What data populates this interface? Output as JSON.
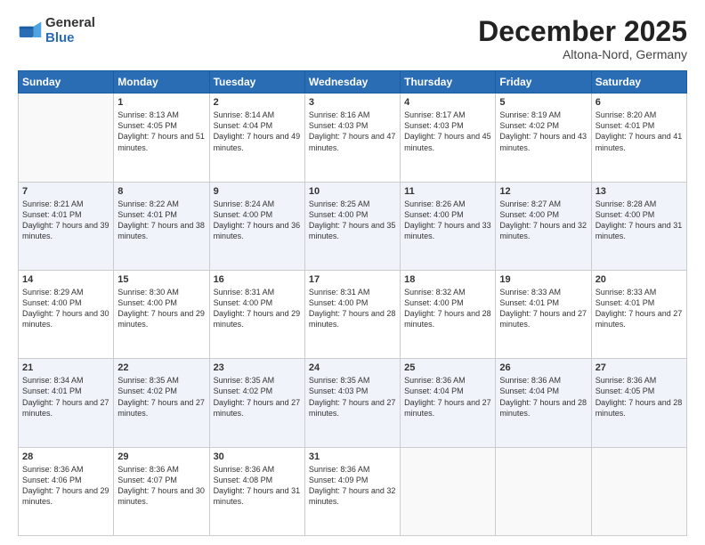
{
  "logo": {
    "general": "General",
    "blue": "Blue"
  },
  "header": {
    "month": "December 2025",
    "location": "Altona-Nord, Germany"
  },
  "weekdays": [
    "Sunday",
    "Monday",
    "Tuesday",
    "Wednesday",
    "Thursday",
    "Friday",
    "Saturday"
  ],
  "weeks": [
    [
      {
        "day": "",
        "sunrise": "",
        "sunset": "",
        "daylight": ""
      },
      {
        "day": "1",
        "sunrise": "Sunrise: 8:13 AM",
        "sunset": "Sunset: 4:05 PM",
        "daylight": "Daylight: 7 hours and 51 minutes."
      },
      {
        "day": "2",
        "sunrise": "Sunrise: 8:14 AM",
        "sunset": "Sunset: 4:04 PM",
        "daylight": "Daylight: 7 hours and 49 minutes."
      },
      {
        "day": "3",
        "sunrise": "Sunrise: 8:16 AM",
        "sunset": "Sunset: 4:03 PM",
        "daylight": "Daylight: 7 hours and 47 minutes."
      },
      {
        "day": "4",
        "sunrise": "Sunrise: 8:17 AM",
        "sunset": "Sunset: 4:03 PM",
        "daylight": "Daylight: 7 hours and 45 minutes."
      },
      {
        "day": "5",
        "sunrise": "Sunrise: 8:19 AM",
        "sunset": "Sunset: 4:02 PM",
        "daylight": "Daylight: 7 hours and 43 minutes."
      },
      {
        "day": "6",
        "sunrise": "Sunrise: 8:20 AM",
        "sunset": "Sunset: 4:01 PM",
        "daylight": "Daylight: 7 hours and 41 minutes."
      }
    ],
    [
      {
        "day": "7",
        "sunrise": "Sunrise: 8:21 AM",
        "sunset": "Sunset: 4:01 PM",
        "daylight": "Daylight: 7 hours and 39 minutes."
      },
      {
        "day": "8",
        "sunrise": "Sunrise: 8:22 AM",
        "sunset": "Sunset: 4:01 PM",
        "daylight": "Daylight: 7 hours and 38 minutes."
      },
      {
        "day": "9",
        "sunrise": "Sunrise: 8:24 AM",
        "sunset": "Sunset: 4:00 PM",
        "daylight": "Daylight: 7 hours and 36 minutes."
      },
      {
        "day": "10",
        "sunrise": "Sunrise: 8:25 AM",
        "sunset": "Sunset: 4:00 PM",
        "daylight": "Daylight: 7 hours and 35 minutes."
      },
      {
        "day": "11",
        "sunrise": "Sunrise: 8:26 AM",
        "sunset": "Sunset: 4:00 PM",
        "daylight": "Daylight: 7 hours and 33 minutes."
      },
      {
        "day": "12",
        "sunrise": "Sunrise: 8:27 AM",
        "sunset": "Sunset: 4:00 PM",
        "daylight": "Daylight: 7 hours and 32 minutes."
      },
      {
        "day": "13",
        "sunrise": "Sunrise: 8:28 AM",
        "sunset": "Sunset: 4:00 PM",
        "daylight": "Daylight: 7 hours and 31 minutes."
      }
    ],
    [
      {
        "day": "14",
        "sunrise": "Sunrise: 8:29 AM",
        "sunset": "Sunset: 4:00 PM",
        "daylight": "Daylight: 7 hours and 30 minutes."
      },
      {
        "day": "15",
        "sunrise": "Sunrise: 8:30 AM",
        "sunset": "Sunset: 4:00 PM",
        "daylight": "Daylight: 7 hours and 29 minutes."
      },
      {
        "day": "16",
        "sunrise": "Sunrise: 8:31 AM",
        "sunset": "Sunset: 4:00 PM",
        "daylight": "Daylight: 7 hours and 29 minutes."
      },
      {
        "day": "17",
        "sunrise": "Sunrise: 8:31 AM",
        "sunset": "Sunset: 4:00 PM",
        "daylight": "Daylight: 7 hours and 28 minutes."
      },
      {
        "day": "18",
        "sunrise": "Sunrise: 8:32 AM",
        "sunset": "Sunset: 4:00 PM",
        "daylight": "Daylight: 7 hours and 28 minutes."
      },
      {
        "day": "19",
        "sunrise": "Sunrise: 8:33 AM",
        "sunset": "Sunset: 4:01 PM",
        "daylight": "Daylight: 7 hours and 27 minutes."
      },
      {
        "day": "20",
        "sunrise": "Sunrise: 8:33 AM",
        "sunset": "Sunset: 4:01 PM",
        "daylight": "Daylight: 7 hours and 27 minutes."
      }
    ],
    [
      {
        "day": "21",
        "sunrise": "Sunrise: 8:34 AM",
        "sunset": "Sunset: 4:01 PM",
        "daylight": "Daylight: 7 hours and 27 minutes."
      },
      {
        "day": "22",
        "sunrise": "Sunrise: 8:35 AM",
        "sunset": "Sunset: 4:02 PM",
        "daylight": "Daylight: 7 hours and 27 minutes."
      },
      {
        "day": "23",
        "sunrise": "Sunrise: 8:35 AM",
        "sunset": "Sunset: 4:02 PM",
        "daylight": "Daylight: 7 hours and 27 minutes."
      },
      {
        "day": "24",
        "sunrise": "Sunrise: 8:35 AM",
        "sunset": "Sunset: 4:03 PM",
        "daylight": "Daylight: 7 hours and 27 minutes."
      },
      {
        "day": "25",
        "sunrise": "Sunrise: 8:36 AM",
        "sunset": "Sunset: 4:04 PM",
        "daylight": "Daylight: 7 hours and 27 minutes."
      },
      {
        "day": "26",
        "sunrise": "Sunrise: 8:36 AM",
        "sunset": "Sunset: 4:04 PM",
        "daylight": "Daylight: 7 hours and 28 minutes."
      },
      {
        "day": "27",
        "sunrise": "Sunrise: 8:36 AM",
        "sunset": "Sunset: 4:05 PM",
        "daylight": "Daylight: 7 hours and 28 minutes."
      }
    ],
    [
      {
        "day": "28",
        "sunrise": "Sunrise: 8:36 AM",
        "sunset": "Sunset: 4:06 PM",
        "daylight": "Daylight: 7 hours and 29 minutes."
      },
      {
        "day": "29",
        "sunrise": "Sunrise: 8:36 AM",
        "sunset": "Sunset: 4:07 PM",
        "daylight": "Daylight: 7 hours and 30 minutes."
      },
      {
        "day": "30",
        "sunrise": "Sunrise: 8:36 AM",
        "sunset": "Sunset: 4:08 PM",
        "daylight": "Daylight: 7 hours and 31 minutes."
      },
      {
        "day": "31",
        "sunrise": "Sunrise: 8:36 AM",
        "sunset": "Sunset: 4:09 PM",
        "daylight": "Daylight: 7 hours and 32 minutes."
      },
      {
        "day": "",
        "sunrise": "",
        "sunset": "",
        "daylight": ""
      },
      {
        "day": "",
        "sunrise": "",
        "sunset": "",
        "daylight": ""
      },
      {
        "day": "",
        "sunrise": "",
        "sunset": "",
        "daylight": ""
      }
    ]
  ]
}
